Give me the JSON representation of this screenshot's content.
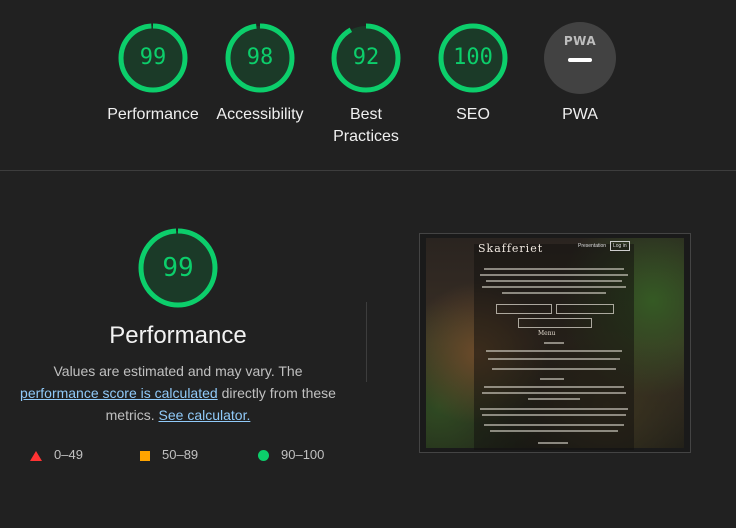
{
  "gauges": [
    {
      "score": "99",
      "label": "Performance",
      "fraction": 0.99
    },
    {
      "score": "98",
      "label": "Accessibility",
      "fraction": 0.98
    },
    {
      "score": "92",
      "label": "Best Practices",
      "fraction": 0.92
    },
    {
      "score": "100",
      "label": "SEO",
      "fraction": 1.0
    }
  ],
  "pwa": {
    "badge": "PWA",
    "label": "PWA"
  },
  "performance": {
    "score": "99",
    "fraction": 0.99,
    "title": "Performance",
    "desc_prefix": "Values are estimated and may vary. The ",
    "desc_link1": "performance score is calculated",
    "desc_middle": " directly from these metrics. ",
    "desc_link2": "See calculator."
  },
  "legend": {
    "fail": "0–49",
    "average": "50–89",
    "pass": "90–100"
  },
  "screenshot": {
    "title": "Skafferiet",
    "nav": "Presentation",
    "login": "Log in",
    "menu_heading": "Menu"
  },
  "colors": {
    "pass": "#0cce6b",
    "average": "#ffa400",
    "fail": "#ff3333",
    "link": "#90caf9"
  }
}
